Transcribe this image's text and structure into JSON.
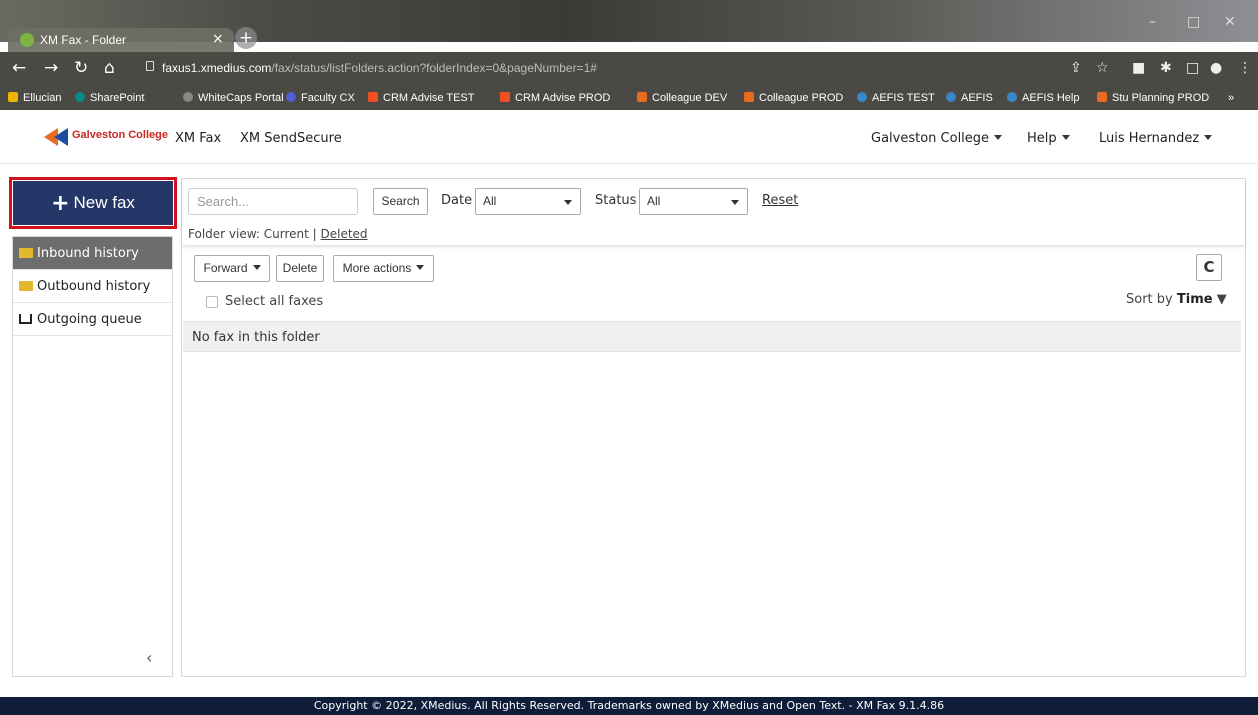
{
  "browser": {
    "tab_title": "XM Fax - Folder",
    "tab_close": "×",
    "new_tab": "+",
    "url_host": "faxus1.xmedius.com",
    "url_path": "/fax/status/listFolders.action?folderIndex=0&pageNumber=1#",
    "bookmarks": [
      "Ellucian",
      "SharePoint",
      "WhiteCaps Portal",
      "Faculty CX",
      "CRM Advise TEST",
      "CRM Advise PROD",
      "Colleague DEV",
      "Colleague PROD",
      "AEFIS TEST",
      "AEFIS",
      "AEFIS Help",
      "Stu Planning PROD"
    ],
    "bookmarks_more": "»"
  },
  "header": {
    "logo_text": "Galveston College",
    "nav": [
      "XM Fax",
      "XM SendSecure"
    ],
    "org_menu": "Galveston College",
    "help_menu": "Help",
    "user_menu": "Luis Hernandez"
  },
  "sidebar": {
    "new_fax_label": "New fax",
    "items": [
      "Inbound history",
      "Outbound history",
      "Outgoing queue"
    ],
    "collapse": "‹"
  },
  "filters": {
    "search_placeholder": "Search...",
    "search_button": "Search",
    "date_label": "Date",
    "date_value": "All",
    "status_label": "Status",
    "status_value": "All",
    "reset": "Reset",
    "folder_view_prefix": "Folder view: Current |",
    "folder_view_deleted": "Deleted"
  },
  "actions": {
    "forward": "Forward",
    "delete": "Delete",
    "more": "More actions",
    "refresh": "C",
    "select_all": "Select all faxes",
    "sort_prefix": "Sort by",
    "sort_field": "Time",
    "sort_dir": "▼"
  },
  "list": {
    "empty_message": "No fax in this folder"
  },
  "footer": {
    "text": "Copyright © 2022, XMedius. All Rights Reserved. Trademarks owned by XMedius and Open Text. - XM Fax 9.1.4.86"
  },
  "colors": {
    "new_fax_bg": "#243568",
    "highlight_border": "#d0141e",
    "active_item_bg": "#6d6d6d",
    "footer_bg": "#0f1d3a"
  }
}
